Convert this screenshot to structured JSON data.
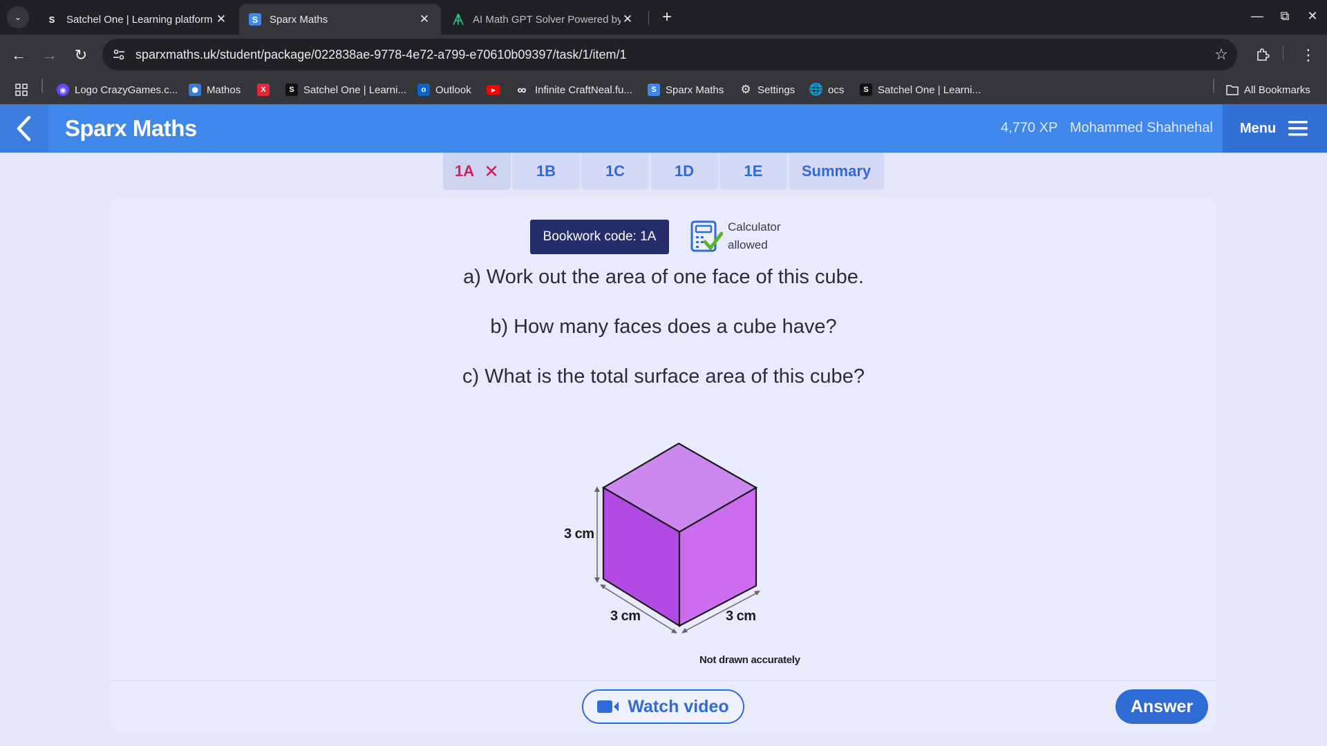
{
  "browser": {
    "tabs": [
      {
        "label": "Satchel One | Learning platform",
        "favicon": "S"
      },
      {
        "label": "Sparx Maths",
        "favicon": "S"
      },
      {
        "label": "AI Math GPT Solver Powered by",
        "favicon": "ai-math-icon"
      }
    ],
    "active_tab_index": 1,
    "url": "sparxmaths.uk/student/package/022838ae-9778-4e72-a799-e70610b09397/task/1/item/1",
    "bookmarks": [
      {
        "label": "Logo CrazyGames.c...",
        "icon": "crazygames-icon",
        "color": "#6842ff"
      },
      {
        "label": "Mathos",
        "icon": "mathos-icon",
        "color": "#3a7bd5"
      },
      {
        "label": "",
        "icon": "red-x-icon",
        "color": "#e8233c"
      },
      {
        "label": "Satchel One | Learni...",
        "icon": "S",
        "color": "#111111"
      },
      {
        "label": "Outlook",
        "icon": "outlook-icon",
        "color": "#0a64c9"
      },
      {
        "label": "",
        "icon": "youtube-icon",
        "color": "#ff0000"
      },
      {
        "label": "Infinite CraftNeal.fu...",
        "icon": "infinity-icon",
        "color": "#ffffff"
      },
      {
        "label": "Sparx Maths",
        "icon": "S",
        "color": "#3f87ea"
      },
      {
        "label": "Settings",
        "icon": "gear-icon",
        "color": "#e8eaed"
      },
      {
        "label": "ocs",
        "icon": "globe-icon",
        "color": "#e8eaed"
      },
      {
        "label": "Satchel One | Learni...",
        "icon": "S",
        "color": "#111111"
      }
    ],
    "all_bookmarks_label": "All Bookmarks"
  },
  "header": {
    "brand": "Sparx Maths",
    "xp": "4,770 XP",
    "student_name": "Mohammed Shahnehal",
    "menu_label": "Menu"
  },
  "task_tabs": [
    {
      "label": "1A",
      "state": "incorrect"
    },
    {
      "label": "1B",
      "state": "pending"
    },
    {
      "label": "1C",
      "state": "pending"
    },
    {
      "label": "1D",
      "state": "pending"
    },
    {
      "label": "1E",
      "state": "pending"
    },
    {
      "label": "Summary",
      "state": "pending"
    }
  ],
  "question": {
    "bookwork_code": "Bookwork code: 1A",
    "calculator_line1": "Calculator",
    "calculator_line2": "allowed",
    "parts": [
      "a) Work out the area of one face of this cube.",
      "b) How many faces does a cube have?",
      "c) What is the total surface area of this cube?"
    ],
    "figure": {
      "height_label": "3 cm",
      "left_base_label": "3 cm",
      "right_base_label": "3 cm",
      "note": "Not drawn accurately"
    }
  },
  "actions": {
    "watch_video": "Watch video",
    "answer": "Answer"
  },
  "colors": {
    "header_blue": "#3f87ea",
    "page_bg": "#e4e6f9",
    "bookwork_bg": "#252e6b",
    "incorrect_red": "#c8235a",
    "cube_top": "#cc88ee",
    "cube_left": "#b44ae4",
    "cube_right": "#cc6df0"
  }
}
